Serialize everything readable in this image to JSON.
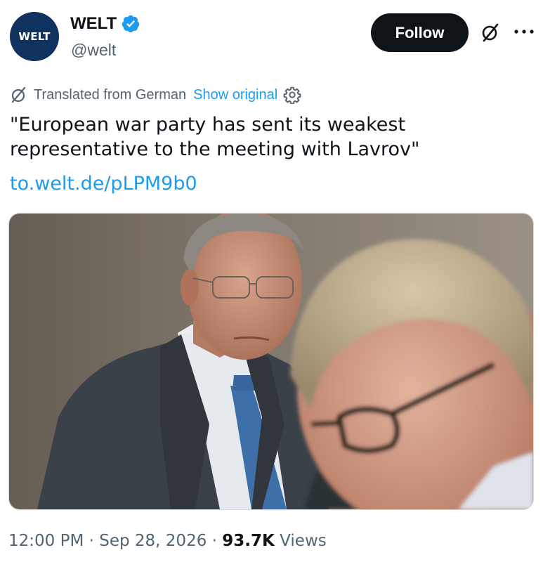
{
  "account": {
    "avatar_text": "WELT",
    "display_name": "WELT",
    "handle": "@welt",
    "verified": true
  },
  "header": {
    "follow_label": "Follow",
    "grok_icon": "grok-icon",
    "more_icon": "more-dots-icon"
  },
  "translation": {
    "label": "Translated from German",
    "show_original": "Show original",
    "settings_icon": "gear-icon"
  },
  "tweet": {
    "text": "\"European war party has sent its weakest\nrepresentative to the meeting with Lavrov\"",
    "link": "to.welt.de/pLPM9b0"
  },
  "meta": {
    "time": "12:00 PM",
    "separator": "·",
    "date": "Sep 28, 2026",
    "views_count": "93.7K",
    "views_label": "Views"
  },
  "colors": {
    "link_blue": "#1d9bf0",
    "avatar_navy": "#10325e",
    "secondary_text": "#536471"
  }
}
